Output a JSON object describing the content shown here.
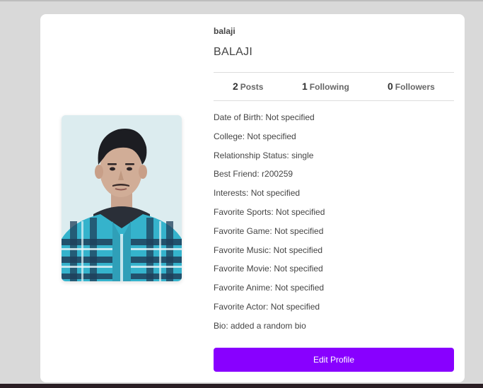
{
  "profile": {
    "username": "balaji",
    "full_name": "BALAJI",
    "stats": {
      "posts_count": "2",
      "posts_label": "Posts",
      "following_count": "1",
      "following_label": "Following",
      "followers_count": "0",
      "followers_label": "Followers"
    },
    "details": [
      "Date of Birth: Not specified",
      "College: Not specified",
      "Relationship Status: single",
      "Best Friend: r200259",
      "Interests: Not specified",
      "Favorite Sports: Not specified",
      "Favorite Game: Not specified",
      "Favorite Music: Not specified",
      "Favorite Movie: Not specified",
      "Favorite Anime: Not specified",
      "Favorite Actor: Not specified",
      "Bio: added a random bio"
    ],
    "edit_button_label": "Edit Profile"
  },
  "colors": {
    "accent": "#8800ff",
    "page_background": "#d9d9d9",
    "card_background": "#ffffff"
  }
}
